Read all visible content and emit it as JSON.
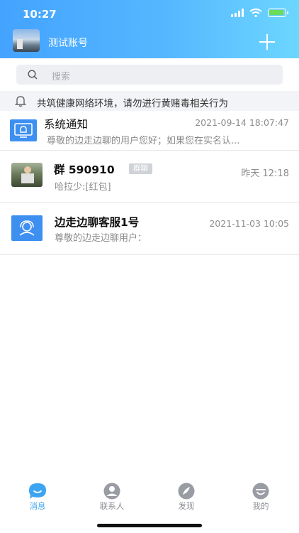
{
  "status_bar": {
    "time": "10:27"
  },
  "header": {
    "account_name": "测试账号"
  },
  "search": {
    "placeholder": "搜索"
  },
  "notice": {
    "text": "共筑健康网络环境，请勿进行黄赌毒相关行为"
  },
  "conversations": [
    {
      "title": "系统通知",
      "time": "2021-09-14 18:07:47",
      "preview": "尊敬的边走边聊的用户您好；如果您在实名认...",
      "icon": "monitor-bell-icon"
    },
    {
      "title": "群 590910",
      "badge": "群聊",
      "time": "昨天 12:18",
      "preview": "哈拉少:[红包]",
      "icon": "group-photo"
    },
    {
      "title": "边走边聊客服1号",
      "time": "2021-11-03 10:05",
      "preview": "尊敬的边走边聊用户：",
      "icon": "customer-service-icon"
    }
  ],
  "tabs": [
    {
      "label": "消息",
      "icon": "message-icon",
      "active": true
    },
    {
      "label": "联系人",
      "icon": "contacts-icon",
      "active": false
    },
    {
      "label": "发现",
      "icon": "discover-icon",
      "active": false
    },
    {
      "label": "我的",
      "icon": "profile-icon",
      "active": false
    }
  ],
  "colors": {
    "accent": "#3da4f2",
    "header_start": "#43a3ff",
    "header_end": "#6dd6ff",
    "icon_blue": "#3d8ff0",
    "inactive": "#8d8f95"
  }
}
